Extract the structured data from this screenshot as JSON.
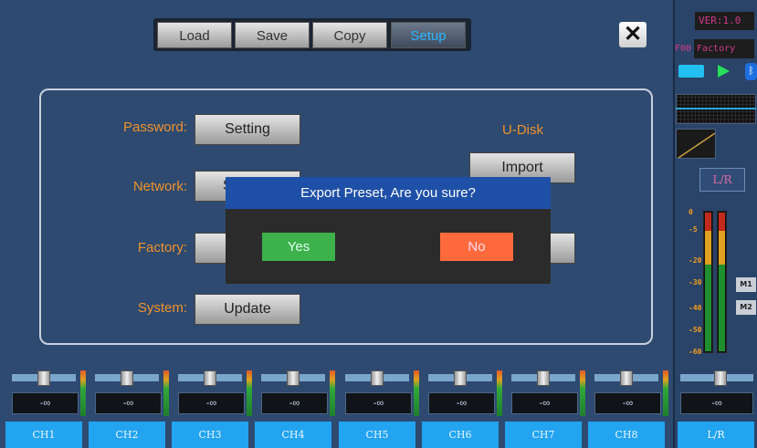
{
  "tabs": [
    {
      "label": "Load"
    },
    {
      "label": "Save"
    },
    {
      "label": "Copy"
    },
    {
      "label": "Setup",
      "active": true
    }
  ],
  "close_icon": "close-icon",
  "setup": {
    "password_label": "Password:",
    "password_button": "Setting",
    "network_label": "Network:",
    "network_button": "S",
    "factory_label": "Factory:",
    "system_label": "System:",
    "system_button": "Update",
    "udisk_label": "U-Disk",
    "import_button": "Import"
  },
  "dialog": {
    "title": "Export Preset, Are you sure?",
    "yes": "Yes",
    "no": "No",
    "yes_color": "#3db14a",
    "no_color": "#ff6a3d"
  },
  "status": {
    "version": "VER:1.0",
    "preset_number": "F00",
    "preset_name": "Factory",
    "icons": [
      "usb-icon",
      "play-icon",
      "bluetooth-icon"
    ],
    "lr_button": "L/R",
    "meter_scale": [
      "0",
      "-5",
      "-20",
      "-30",
      "-40",
      "-50",
      "-60"
    ],
    "m1": "M1",
    "m2": "M2"
  },
  "channels": [
    {
      "name": "CH1",
      "value": "-∞"
    },
    {
      "name": "CH2",
      "value": "-∞"
    },
    {
      "name": "CH3",
      "value": "-∞"
    },
    {
      "name": "CH4",
      "value": "-∞"
    },
    {
      "name": "CH5",
      "value": "-∞"
    },
    {
      "name": "CH6",
      "value": "-∞"
    },
    {
      "name": "CH7",
      "value": "-∞"
    },
    {
      "name": "CH8",
      "value": "-∞"
    },
    {
      "name": "L/R",
      "value": "-∞"
    }
  ],
  "colors": {
    "background": "#2e4a70",
    "accent_orange": "#f0922a",
    "channel_button": "#22a4f0",
    "active_tab_text": "#2bb6ff"
  }
}
